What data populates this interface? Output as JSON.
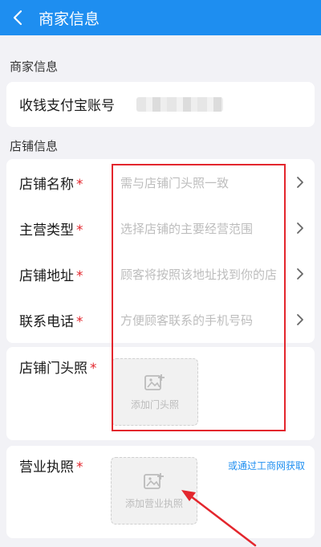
{
  "navbar": {
    "title": "商家信息"
  },
  "sections": {
    "merchant": "商家信息",
    "store": "店铺信息"
  },
  "merchant": {
    "alipay_label": "收钱支付宝账号"
  },
  "store_rows": [
    {
      "label": "店铺名称",
      "placeholder": "需与店铺门头照一致"
    },
    {
      "label": "主营类型",
      "placeholder": "选择店铺的主要经营范围"
    },
    {
      "label": "店铺地址",
      "placeholder": "顾客将按照该地址找到你的店"
    },
    {
      "label": "联系电话",
      "placeholder": "方便顾客联系的手机号码"
    }
  ],
  "storefront": {
    "label": "店铺门头照",
    "upload_label": "添加门头照"
  },
  "license": {
    "label": "营业执照",
    "upload_label": "添加营业执照",
    "link": "或通过工商网获取"
  },
  "required_mark": "*",
  "icons": {
    "back": "chevron-left-icon",
    "row_chevron": "chevron-right-icon",
    "add_photo": "add-image-icon"
  },
  "colors": {
    "brand": "#1e8ef0",
    "required": "#e3262d",
    "placeholder": "#bdbdbd",
    "annotation": "#e3262d"
  }
}
